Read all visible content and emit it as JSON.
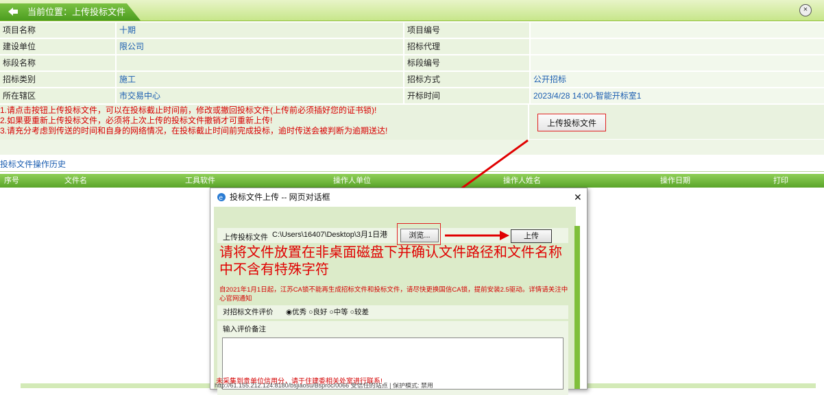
{
  "location": {
    "label": "当前位置：上传投标文件"
  },
  "info": {
    "rows": [
      {
        "l1": "项目名称",
        "v1": "十期",
        "l2": "项目编号",
        "v2": ""
      },
      {
        "l1": "建设单位",
        "v1": "限公司",
        "l2": "招标代理",
        "v2": ""
      },
      {
        "l1": "标段名称",
        "v1": "",
        "l2": "标段编号",
        "v2": ""
      },
      {
        "l1": "招标类别",
        "v1": "施工",
        "l2": "招标方式",
        "v2": "公开招标"
      },
      {
        "l1": "所在辖区",
        "v1": "市交易中心",
        "l2": "开标时间",
        "v2": "2023/4/28 14:00-智能开标室1"
      }
    ]
  },
  "notes": [
    "1.请点击按钮上传投标文件，可以在投标截止时间前，修改或撤回投标文件(上传前必须插好您的证书锁)!",
    "2.如果要重新上传投标文件，必须将上次上传的投标文件撤销才可重新上传!",
    "3.请充分考虑到传送的时间和自身的网络情况，在投标截止时间前完成投标，逾时传送会被判断为逾期送达!"
  ],
  "upload_button": "上传投标文件",
  "history": {
    "title": "投标文件操作历史",
    "columns": [
      "序号",
      "文件名",
      "工具软件",
      "操作人单位",
      "操作人姓名",
      "操作日期",
      "打印"
    ]
  },
  "dialog": {
    "title": "投标文件上传 -- 网页对话框",
    "file_label": "上传投标文件",
    "file_path": "C:\\Users\\16407\\Desktop\\3月1日港",
    "browse": "浏览...",
    "upload": "上传",
    "warning_big": "请将文件放置在非桌面磁盘下并确认文件路径和文件名称中不含有特殊字符",
    "warning_small": "自2021年1月1日起，江苏CA锁不能再生成招标文件和投标文件，请尽快更换国信CA锁，提前安装2.5驱动。详情请关注中心官网通知",
    "rating_label": "对招标文件评价",
    "rating_options": [
      "优秀",
      "良好",
      "中等",
      "较差"
    ],
    "rating_selected": "优秀",
    "comment_label": "输入评价备注",
    "footer_note": "未采集到贵单位信用分，请于住建委相关处室进行联系!",
    "status_text": "http://61.155.212.124:8180/bsjiaosu/Bsproc/0066   受信任的站点 | 保护模式: 禁用"
  },
  "colors": {
    "accent_green": "#5aa52a",
    "alert_red": "#e00000",
    "link_blue": "#1a5db0"
  }
}
